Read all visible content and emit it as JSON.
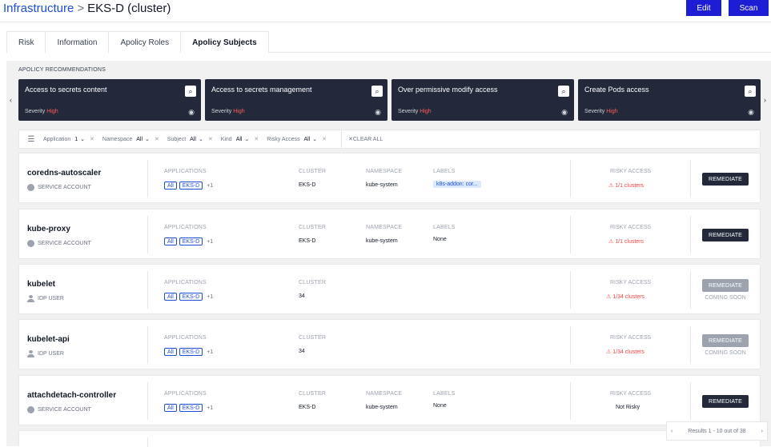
{
  "header": {
    "breadcrumb_root": "Infrastructure",
    "breadcrumb_sep": ">",
    "breadcrumb_current": "EKS-D (cluster)",
    "edit_label": "Edit",
    "scan_label": "Scan"
  },
  "tabs": [
    {
      "label": "Risk"
    },
    {
      "label": "Information"
    },
    {
      "label": "Apolicy Roles"
    },
    {
      "label": "Apolicy Subjects",
      "active": true
    }
  ],
  "recommendations": {
    "title": "APOLICY RECOMMENDATIONS",
    "severity_label": "Severity",
    "cards": [
      {
        "title": "Access to secrets content",
        "severity": "High"
      },
      {
        "title": "Access to secrets management",
        "severity": "High"
      },
      {
        "title": "Over permissive modify access",
        "severity": "High"
      },
      {
        "title": "Create Pods access",
        "severity": "High"
      }
    ]
  },
  "filters": {
    "items": [
      {
        "label": "Application",
        "value": "1"
      },
      {
        "label": "Namespace",
        "value": "All"
      },
      {
        "label": "Subject",
        "value": "All"
      },
      {
        "label": "Kind",
        "value": "All"
      },
      {
        "label": "Risky Access",
        "value": "All"
      }
    ],
    "clear_all": "CLEAR ALL"
  },
  "columns": {
    "applications": "APPLICATIONS",
    "cluster": "CLUSTER",
    "namespace": "NAMESPACE",
    "labels": "LABELS",
    "risky_access": "RISKY ACCESS"
  },
  "rows": [
    {
      "name": "coredns-autoscaler",
      "kind": "SERVICE ACCOUNT",
      "tag1": "All",
      "tag2": "EKS-D",
      "more": "+1",
      "cluster": "EKS-D",
      "namespace": "kube-system",
      "labels": "k8s-addon: cor...",
      "risk": "1/1 clusters",
      "action": "REMEDIATE"
    },
    {
      "name": "kube-proxy",
      "kind": "SERVICE ACCOUNT",
      "tag1": "All",
      "tag2": "EKS-D",
      "more": "+1",
      "cluster": "EKS-D",
      "namespace": "kube-system",
      "labels": "None",
      "risk": "1/1 clusters",
      "action": "REMEDIATE"
    },
    {
      "name": "kubelet",
      "kind": "IDP USER",
      "tag1": "All",
      "tag2": "EKS-D",
      "more": "+1",
      "cluster": "34",
      "risk": "1/34 clusters",
      "action": "REMEDIATE",
      "note": "COMING SOON"
    },
    {
      "name": "kubelet-api",
      "kind": "IDP USER",
      "tag1": "All",
      "tag2": "EKS-D",
      "more": "+1",
      "cluster": "34",
      "risk": "1/34 clusters",
      "action": "REMEDIATE",
      "note": "COMING SOON"
    },
    {
      "name": "attachdetach-controller",
      "kind": "SERVICE ACCOUNT",
      "tag1": "All",
      "tag2": "EKS-D",
      "more": "+1",
      "cluster": "EKS-D",
      "namespace": "kube-system",
      "labels": "None",
      "risk": "Not Risky",
      "action": "REMEDIATE"
    }
  ],
  "pager": {
    "text": "Results 1 - 10 out of 38"
  }
}
